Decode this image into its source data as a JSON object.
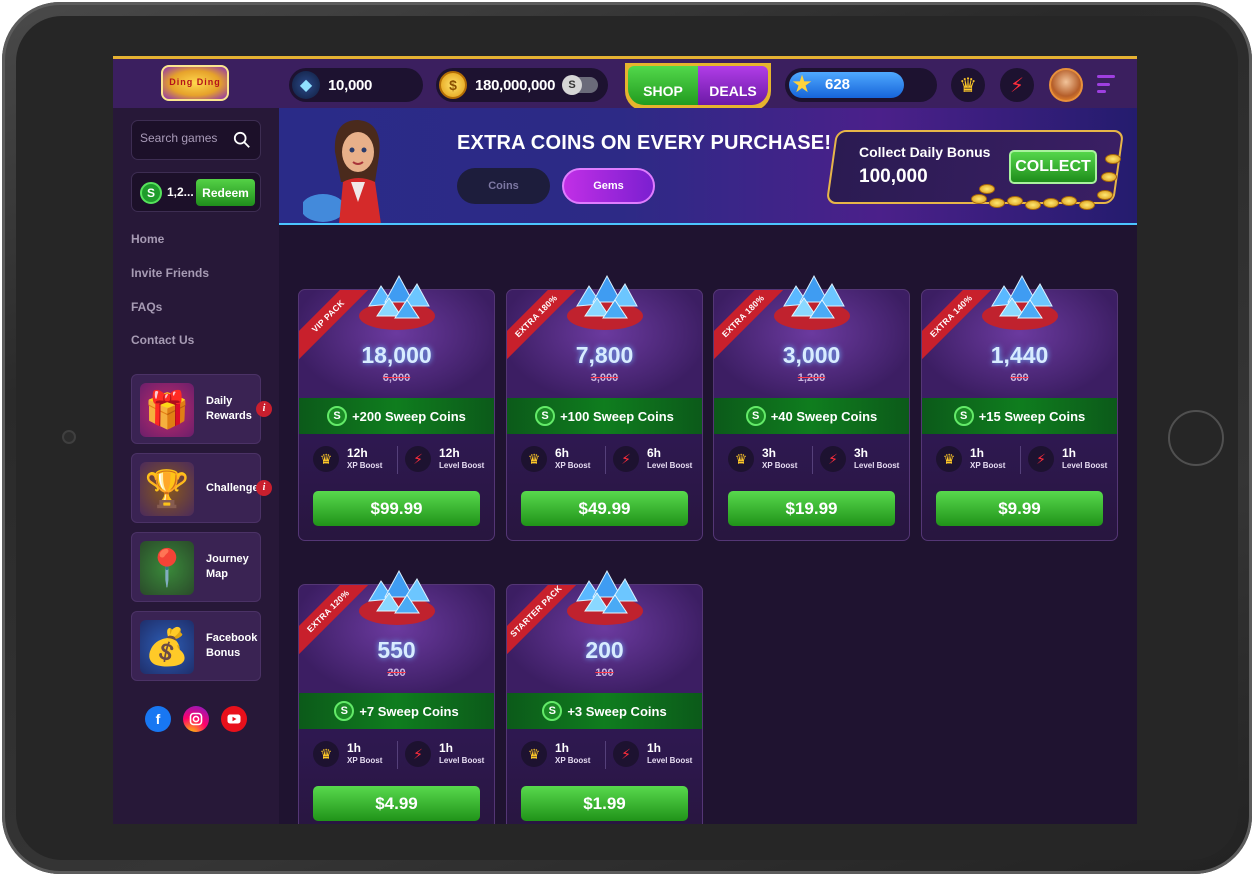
{
  "header": {
    "logo_text": "Ding Ding Ding 777",
    "gems": "10,000",
    "coins": "180,000,000",
    "toggle_icon": "S",
    "tabs": [
      {
        "label": "SHOP"
      },
      {
        "label": "DEALS"
      }
    ],
    "xp": "628",
    "xp_progress": 0.8
  },
  "sidebar": {
    "search_placeholder": "Search games",
    "sweep_balance": "1,2...",
    "redeem_label": "Redeem",
    "nav": [
      "Home",
      "Invite Friends",
      "FAQs",
      "Contact Us"
    ],
    "cards": [
      {
        "label": "Daily Rewards",
        "icon": "gift-icon"
      },
      {
        "label": "Challenges",
        "icon": "trophy-icon"
      },
      {
        "label": "Journey Map",
        "icon": "map-icon"
      },
      {
        "label": "Facebook Bonus",
        "icon": "facebook-gift-icon"
      }
    ],
    "info_badge": "i",
    "social": [
      "f",
      "ig",
      "yt"
    ]
  },
  "banner": {
    "title": "EXTRA COINS ON EVERY PURCHASE!",
    "tab_coins": "Coins",
    "tab_gems": "Gems",
    "bonus_label": "Collect Daily Bonus",
    "bonus_amount": "100,000",
    "collect_label": "COLLECT"
  },
  "packs": [
    {
      "ribbon": "VIP PACK",
      "amount": "18,000",
      "old": "6,000",
      "sweep": "+200 Sweep Coins",
      "xp": "12h",
      "lvl": "12h",
      "price": "$99.99"
    },
    {
      "ribbon": "EXTRA 180%",
      "amount": "7,800",
      "old": "3,000",
      "sweep": "+100 Sweep Coins",
      "xp": "6h",
      "lvl": "6h",
      "price": "$49.99"
    },
    {
      "ribbon": "EXTRA 180%",
      "amount": "3,000",
      "old": "1,200",
      "sweep": "+40 Sweep Coins",
      "xp": "3h",
      "lvl": "3h",
      "price": "$19.99"
    },
    {
      "ribbon": "EXTRA 140%",
      "amount": "1,440",
      "old": "600",
      "sweep": "+15 Sweep Coins",
      "xp": "1h",
      "lvl": "1h",
      "price": "$9.99"
    },
    {
      "ribbon": "EXTRA 120%",
      "amount": "550",
      "old": "200",
      "sweep": "+7 Sweep Coins",
      "xp": "1h",
      "lvl": "1h",
      "price": "$4.99"
    },
    {
      "ribbon": "STARTER PACK",
      "amount": "200",
      "old": "100",
      "sweep": "+3 Sweep Coins",
      "xp": "1h",
      "lvl": "1h",
      "price": "$1.99"
    }
  ],
  "boost_labels": {
    "xp": "XP Boost",
    "level": "Level Boost"
  },
  "colors": {
    "accent_gold": "#e5b232",
    "buy_green": "#2fa524",
    "ribbon_red": "#c8202c",
    "panel_purple": "#3b1f5f"
  }
}
